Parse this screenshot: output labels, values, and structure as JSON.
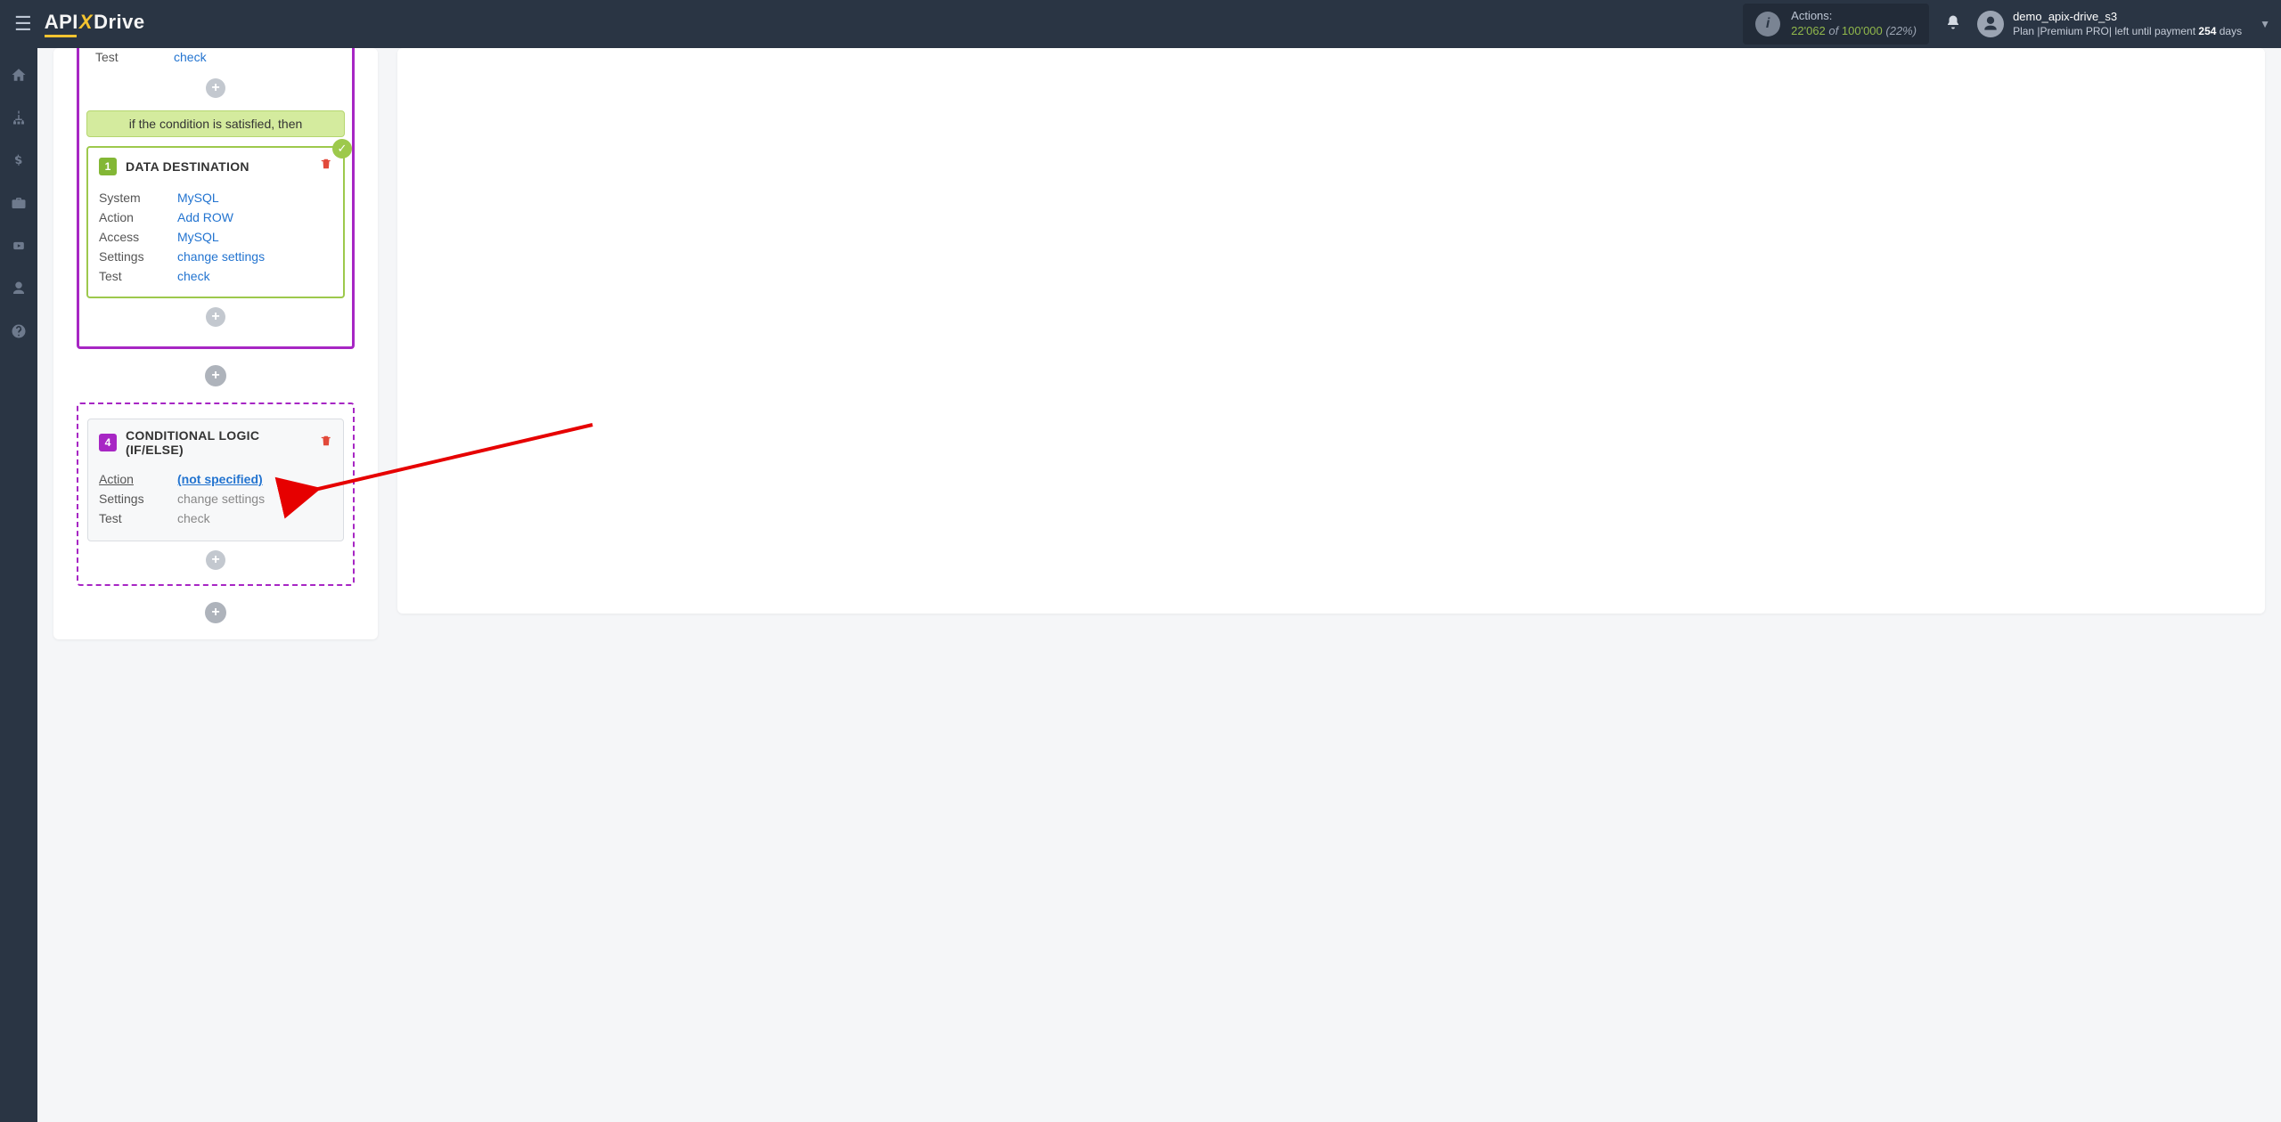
{
  "header": {
    "logo_api": "API",
    "logo_x": "X",
    "logo_drive": "Drive",
    "actions_label": "Actions:",
    "actions_count": "22'062",
    "actions_of": "of",
    "actions_total": "100'000",
    "actions_pct": "(22%)",
    "user_name": "demo_apix-drive_s3",
    "plan_prefix": "Plan |",
    "plan_name": "Premium PRO",
    "plan_mid": "| left until payment ",
    "plan_days": "254",
    "plan_suffix": " days"
  },
  "blocks": {
    "test_label": "Test",
    "test_link": "check",
    "cond_text": "if the condition is satisfied, then",
    "dest_num": "1",
    "dest_title": "DATA DESTINATION",
    "dest": {
      "system_k": "System",
      "system_v": "MySQL",
      "action_k": "Action",
      "action_v": "Add ROW",
      "access_k": "Access",
      "access_v": "MySQL",
      "settings_k": "Settings",
      "settings_v": "change settings",
      "test_k": "Test",
      "test_v": "check"
    },
    "cl_num": "4",
    "cl_title": "CONDITIONAL LOGIC (IF/ELSE)",
    "cl": {
      "action_k": "Action",
      "action_v": "(not specified)",
      "settings_k": "Settings",
      "settings_v": "change settings",
      "test_k": "Test",
      "test_v": "check"
    }
  }
}
